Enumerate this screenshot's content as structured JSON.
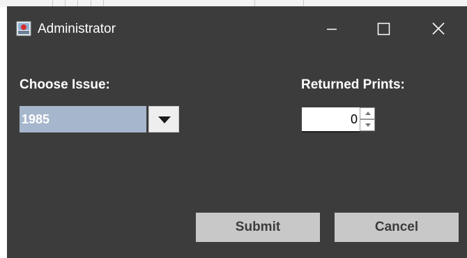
{
  "window": {
    "title": "Administrator",
    "icon": "java-app-icon",
    "controls": {
      "minimize_icon": "minimize-icon",
      "maximize_icon": "maximize-icon",
      "close_icon": "close-icon"
    }
  },
  "form": {
    "issue_label": "Choose Issue:",
    "issue_selected": "1985",
    "returned_label": "Returned Prints:",
    "returned_value": "0"
  },
  "buttons": {
    "submit_label": "Submit",
    "cancel_label": "Cancel"
  },
  "colors": {
    "window_bg": "#3c3c3c",
    "combo_selected_bg": "#a6b6cc",
    "button_bg": "#c8c8c8",
    "text_light": "#ffffff"
  }
}
